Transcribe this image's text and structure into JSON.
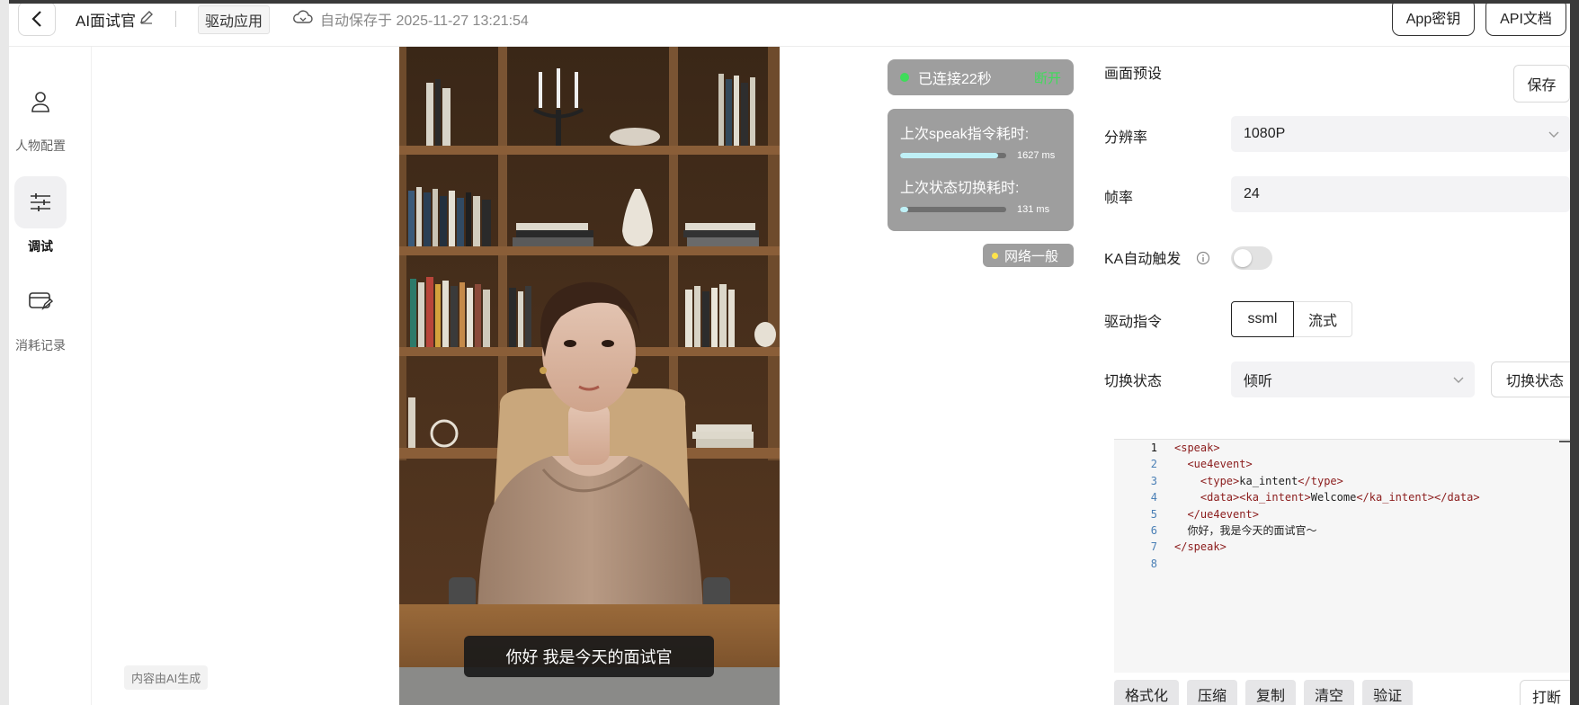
{
  "header": {
    "app_title": "AI面试官",
    "tag": "驱动应用",
    "autosave": "自动保存于 2025-11-27 13:21:54",
    "app_key_label": "App密钥",
    "api_doc_label": "API文档"
  },
  "sidebar": {
    "items": [
      {
        "label": "人物配置",
        "icon": "person-icon"
      },
      {
        "label": "调试",
        "icon": "sliders-icon",
        "active": true
      },
      {
        "label": "消耗记录",
        "icon": "card-edit-icon"
      }
    ]
  },
  "video": {
    "subtitle": "你好 我是今天的面试官",
    "ai_generated_label": "内容由AI生成"
  },
  "connection": {
    "status": "已连接22秒",
    "disconnect_label": "断开",
    "speak_latency_label": "上次speak指令耗时:",
    "speak_latency_value": "1627 ms",
    "speak_latency_fill": 0.92,
    "switch_latency_label": "上次状态切换耗时:",
    "switch_latency_value": "131 ms",
    "switch_latency_fill": 0.08,
    "network_label": "网络一般"
  },
  "settings": {
    "preset_label": "画面预设",
    "save_label": "保存",
    "resolution_label": "分辨率",
    "resolution_value": "1080P",
    "framerate_label": "帧率",
    "framerate_value": "24",
    "ka_label": "KA自动触发",
    "ka_enabled": false,
    "drive_cmd_label": "驱动指令",
    "drive_opts": [
      "ssml",
      "流式"
    ],
    "switch_state_label": "切换状态",
    "state_value": "倾听",
    "switch_state_button": "切换状态"
  },
  "editor": {
    "line_numbers": [
      "1",
      "2",
      "3",
      "4",
      "5",
      "6",
      "7",
      "8"
    ],
    "l1_tag": "<speak>",
    "l2_tag": "<ue4event>",
    "l3_open": "<type>",
    "l3_text": "ka_intent",
    "l3_close": "</type>",
    "l4_open": "<data>",
    "l4_inner_open": "<ka_intent>",
    "l4_text": "Welcome",
    "l4_inner_close": "</ka_intent>",
    "l4_close": "</data>",
    "l5_tag": "</ue4event>",
    "l6_text": "你好，我是今天的面试官～",
    "l7_tag": "</speak>"
  },
  "toolbar": {
    "buttons": [
      "格式化",
      "压缩",
      "复制",
      "清空",
      "验证"
    ],
    "interrupt_label": "打断"
  }
}
